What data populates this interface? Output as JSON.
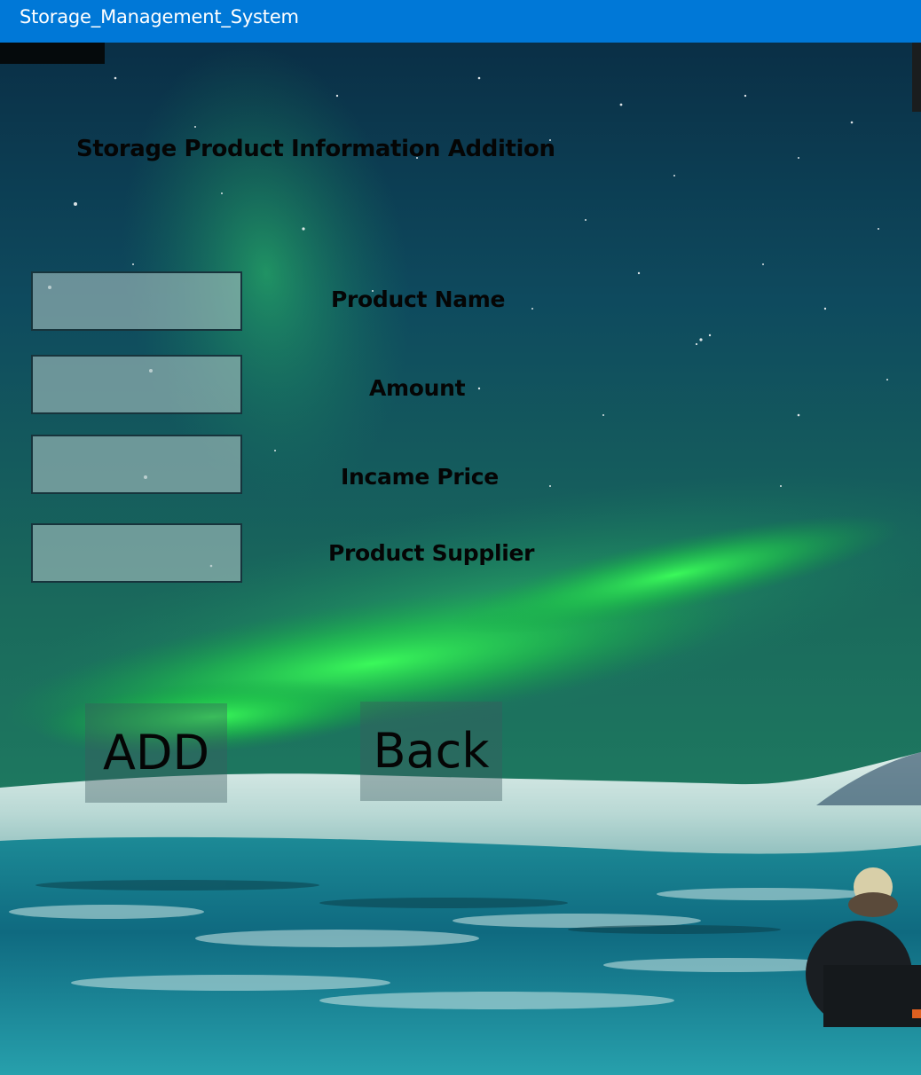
{
  "window": {
    "title": "Storage_Management_System"
  },
  "form": {
    "title": "Storage Product Information Addition",
    "fields": [
      {
        "label": "Product Name",
        "value": "",
        "placeholder": ""
      },
      {
        "label": "Amount",
        "value": "",
        "placeholder": ""
      },
      {
        "label": "Incame Price",
        "value": "",
        "placeholder": ""
      },
      {
        "label": "Product Supplier",
        "value": "",
        "placeholder": ""
      }
    ]
  },
  "buttons": {
    "add_label": "ADD",
    "back_label": "Back"
  },
  "colors": {
    "titlebar": "#0078d7",
    "titlebar_text": "#ffffff",
    "aurora": "#2ee85a",
    "sky": "#0e4a5a",
    "label_text": "#050505"
  },
  "icons": {
    "background": "aurora-landscape-image"
  }
}
